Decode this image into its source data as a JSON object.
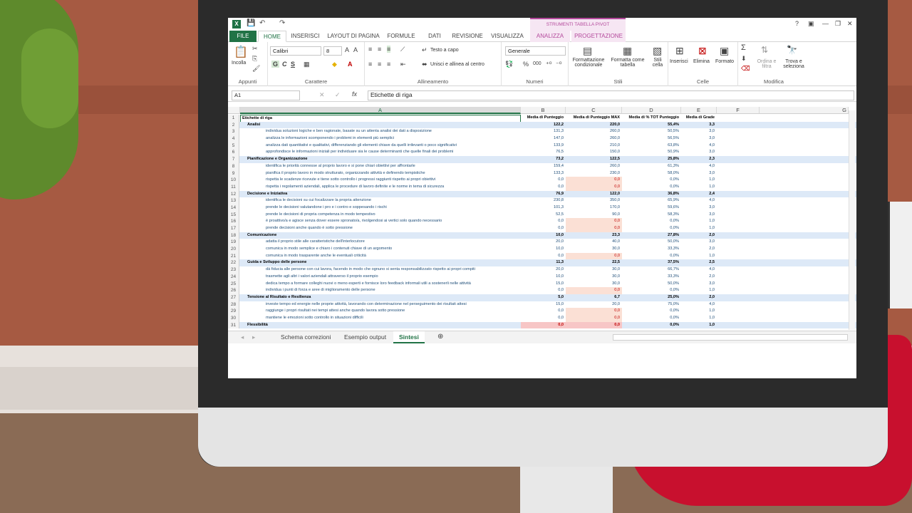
{
  "window": {
    "context_tab_title": "STRUMENTI TABELLA PIVOT",
    "help": "?"
  },
  "tabs": [
    "FILE",
    "HOME",
    "INSERISCI",
    "LAYOUT DI PAGINA",
    "FORMULE",
    "DATI",
    "REVISIONE",
    "VISUALIZZA",
    "ANALIZZA",
    "PROGETTAZIONE"
  ],
  "ribbon": {
    "incolla": "Incolla",
    "appunti": "Appunti",
    "font": "Calibri",
    "size": "8",
    "carattere": "Carattere",
    "testo_a_capo": "Testo a capo",
    "unisci": "Unisci e allinea al centro",
    "allineamento": "Allineamento",
    "number_format": "Generale",
    "numeri": "Numeri",
    "pct": "%",
    "thousands": "000",
    "formattazione": "Formattazione condizionale",
    "formatta_tabella": "Formatta come tabella",
    "stili_cella": "Stili cella",
    "stili": "Stili",
    "inserisci": "Inserisci",
    "elimina": "Elimina",
    "formato": "Formato",
    "celle": "Celle",
    "ordina": "Ordina e filtra",
    "trova": "Trova e seleziona",
    "modifica": "Modifica",
    "bold": "G",
    "italic": "C",
    "underline": "S"
  },
  "formula_bar": {
    "name_box": "A1",
    "content": "Etichette di riga",
    "fx": "fx"
  },
  "columns": [
    "A",
    "B",
    "C",
    "D",
    "E",
    "F",
    "G"
  ],
  "header_row": {
    "n": "1",
    "a": "Etichette di riga",
    "b": "Media di Punteggio",
    "c": "Media di Punteggio MAX",
    "d": "Media di % TOT Punteggio",
    "e": "Media di Grade"
  },
  "rows": [
    {
      "n": "2",
      "type": "group",
      "a": "Analisi",
      "b": "122,2",
      "c": "220,0",
      "d": "55,4%",
      "e": "3,3"
    },
    {
      "n": "3",
      "type": "child",
      "a": "individua soluzioni logiche e ben ragionate, basate su un attenta analisi dei dati a disposizione",
      "b": "131,3",
      "c": "260,0",
      "d": "50,5%",
      "e": "3,0"
    },
    {
      "n": "4",
      "type": "child",
      "a": "analizza le informazioni scomponendo i problemi in elementi più semplici",
      "b": "147,0",
      "c": "260,0",
      "d": "56,5%",
      "e": "3,0"
    },
    {
      "n": "5",
      "type": "child",
      "a": "analizza dati quantitativi e qualitativi, differenziando gli elementi chiave da quelli irrilevanti o poco significativi",
      "b": "133,9",
      "c": "210,0",
      "d": "63,8%",
      "e": "4,0"
    },
    {
      "n": "6",
      "type": "child",
      "a": "approfondisce le informazioni iniziali per individuare sia le cause determinanti che quelle finali dei problemi",
      "b": "76,5",
      "c": "150,0",
      "d": "50,9%",
      "e": "3,0"
    },
    {
      "n": "7",
      "type": "group",
      "a": "Pianificazione e Organizzazione",
      "b": "73,2",
      "c": "122,5",
      "d": "25,8%",
      "e": "2,3"
    },
    {
      "n": "8",
      "type": "child",
      "a": "identifica le priorità connesse al proprio lavoro e si pone chiari obiettivi per affrontarle",
      "b": "159,4",
      "c": "260,0",
      "d": "61,3%",
      "e": "4,0"
    },
    {
      "n": "9",
      "type": "child",
      "a": "pianifica il proprio lavoro in modo strutturato, organizzando attività e definendo tempistiche",
      "b": "133,3",
      "c": "230,0",
      "d": "58,0%",
      "e": "3,0"
    },
    {
      "n": "10",
      "type": "child",
      "a": "rispetta le scadenze ricevute e tiene sotto controllo i progressi raggiunti rispetto ai propri obiettivi",
      "b": "0,0",
      "c": "0,0",
      "d": "0,0%",
      "e": "1,0",
      "pink": true
    },
    {
      "n": "11",
      "type": "child",
      "a": "rispetta i regolamenti aziendali, applica le procedure di lavoro definite e le norme in tema di sicurezza",
      "b": "0,0",
      "c": "0,0",
      "d": "0,0%",
      "e": "1,0",
      "pink": true
    },
    {
      "n": "12",
      "type": "group",
      "a": "Decisione e Iniziativa",
      "b": "76,9",
      "c": "122,0",
      "d": "36,8%",
      "e": "2,4"
    },
    {
      "n": "13",
      "type": "child",
      "a": "identifica le decisioni su cui focalizzare la propria attenzione",
      "b": "230,8",
      "c": "350,0",
      "d": "65,9%",
      "e": "4,0"
    },
    {
      "n": "14",
      "type": "child",
      "a": "prende le decisioni valutandone i pro e i contro e soppesando i rischi",
      "b": "101,3",
      "c": "170,0",
      "d": "59,6%",
      "e": "3,0"
    },
    {
      "n": "15",
      "type": "child",
      "a": "prende le decisioni di propria competenza in modo tempestivo",
      "b": "52,5",
      "c": "90,0",
      "d": "58,3%",
      "e": "3,0"
    },
    {
      "n": "16",
      "type": "child",
      "a": "è proattivo/a e agisce senza dover essere spronato/a, rivolgendosi ai vertici solo quando necessario",
      "b": "0,0",
      "c": "0,0",
      "d": "0,0%",
      "e": "1,0",
      "pink": true
    },
    {
      "n": "17",
      "type": "child",
      "a": "prende decisioni anche quando è sotto pressione",
      "b": "0,0",
      "c": "0,0",
      "d": "0,0%",
      "e": "1,0",
      "pink": true
    },
    {
      "n": "18",
      "type": "group",
      "a": "Comunicazione",
      "b": "10,0",
      "c": "23,3",
      "d": "27,8%",
      "e": "2,0"
    },
    {
      "n": "19",
      "type": "child",
      "a": "adatta il proprio stile alle caratteristiche dell'interlocutore",
      "b": "20,0",
      "c": "40,0",
      "d": "50,0%",
      "e": "3,0"
    },
    {
      "n": "20",
      "type": "child",
      "a": "comunica in modo semplice e chiaro i contenuti chiave di un argomento",
      "b": "10,0",
      "c": "30,0",
      "d": "33,3%",
      "e": "2,0"
    },
    {
      "n": "21",
      "type": "child",
      "a": "comunica in modo trasparente anche le eventuali criticità",
      "b": "0,0",
      "c": "0,0",
      "d": "0,0%",
      "e": "1,0",
      "pink": true
    },
    {
      "n": "22",
      "type": "group",
      "a": "Guida e Sviluppo delle persone",
      "b": "11,3",
      "c": "22,5",
      "d": "37,5%",
      "e": "2,5"
    },
    {
      "n": "23",
      "type": "child",
      "a": "dà fiducia alle persone con cui lavora, facendo in modo che ognuno si senta responsabilizzato rispetto ai propri compiti",
      "b": "20,0",
      "c": "30,0",
      "d": "66,7%",
      "e": "4,0"
    },
    {
      "n": "24",
      "type": "child",
      "a": "trasmette agli altri i valori aziendali attraverso il proprio esempio",
      "b": "10,0",
      "c": "30,0",
      "d": "33,3%",
      "e": "2,0"
    },
    {
      "n": "25",
      "type": "child",
      "a": "dedica tempo a formare colleghi nuovi o meno esperti e fornisce loro feedback informali utili a sostenerli nelle attività",
      "b": "15,0",
      "c": "30,0",
      "d": "50,0%",
      "e": "3,0"
    },
    {
      "n": "26",
      "type": "child",
      "a": "individua i punti di forza e aree di miglioramento delle persone",
      "b": "0,0",
      "c": "0,0",
      "d": "0,0%",
      "e": "1,0",
      "pink": true
    },
    {
      "n": "27",
      "type": "group",
      "a": "Tensione al Risultato e Resilienza",
      "b": "5,0",
      "c": "6,7",
      "d": "25,0%",
      "e": "2,0"
    },
    {
      "n": "28",
      "type": "child",
      "a": "investe tempo ed energie nelle proprie attività, lavorando con determinazione nel perseguimento dei risultati attesi",
      "b": "15,0",
      "c": "20,0",
      "d": "75,0%",
      "e": "4,0"
    },
    {
      "n": "29",
      "type": "child",
      "a": "raggiunge i propri risultati nei tempi attesi anche quando lavora sotto pressione",
      "b": "0,0",
      "c": "0,0",
      "d": "0,0%",
      "e": "1,0",
      "pink": true
    },
    {
      "n": "30",
      "type": "child",
      "a": "mantiene le emozioni sotto controllo in situazioni difficili",
      "b": "0,0",
      "c": "0,0",
      "d": "0,0%",
      "e": "1,0",
      "pink": true
    },
    {
      "n": "31",
      "type": "group",
      "a": "Flessibilità",
      "b": "0,0",
      "c": "0,0",
      "d": "0,0%",
      "e": "1,0",
      "pinkred": true
    }
  ],
  "sheet_tabs": [
    "Schema correzioni",
    "Esempio output",
    "Sintesi"
  ],
  "active_sheet": "Sintesi",
  "add_sheet": "⊕"
}
